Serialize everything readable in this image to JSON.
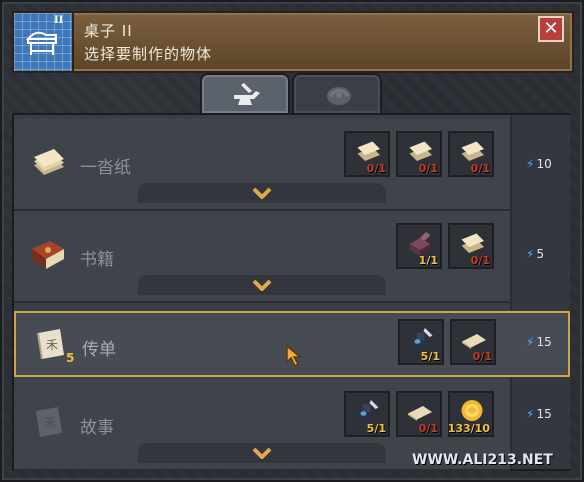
{
  "header": {
    "title": "桌子 II",
    "subtitle": "选择要制作的物体",
    "close_label": "✕",
    "tier_badge": "II"
  },
  "tabs": [
    {
      "name": "crafting",
      "icon": "anvil-hammer-icon",
      "active": true
    },
    {
      "name": "decor",
      "icon": "shell-icon",
      "active": false
    }
  ],
  "recipes": [
    {
      "label": "一沓纸",
      "icon": "paper-stack-icon",
      "ingredients": [
        {
          "icon": "paper-stack-icon",
          "count": "0/1",
          "ok": false
        },
        {
          "icon": "paper-stack-icon",
          "count": "0/1",
          "ok": false
        },
        {
          "icon": "paper-stack-icon",
          "count": "0/1",
          "ok": false
        }
      ],
      "energy": "10"
    },
    {
      "label": "书籍",
      "icon": "book-icon",
      "ingredients": [
        {
          "icon": "box-icon",
          "count": "1/1",
          "ok": true
        },
        {
          "icon": "paper-stack-icon",
          "count": "0/1",
          "ok": false
        }
      ],
      "energy": "5"
    },
    {
      "label": "传单",
      "icon": "scroll-icon",
      "qty": "5",
      "selected": true,
      "ingredients": [
        {
          "icon": "ink-bottle-icon",
          "count": "5/1",
          "ok": true
        },
        {
          "icon": "cloth-icon",
          "count": "0/1",
          "ok": false
        }
      ],
      "energy": "15"
    },
    {
      "label": "故事",
      "icon": "scroll-icon",
      "ingredients": [
        {
          "icon": "ink-bottle-icon",
          "count": "5/1",
          "ok": true
        },
        {
          "icon": "cloth-icon",
          "count": "0/1",
          "ok": false
        },
        {
          "icon": "gold-coin-icon",
          "count": "133/10",
          "ok": true
        }
      ],
      "energy": "15"
    }
  ],
  "watermark": "WWW.ALI213.NET"
}
